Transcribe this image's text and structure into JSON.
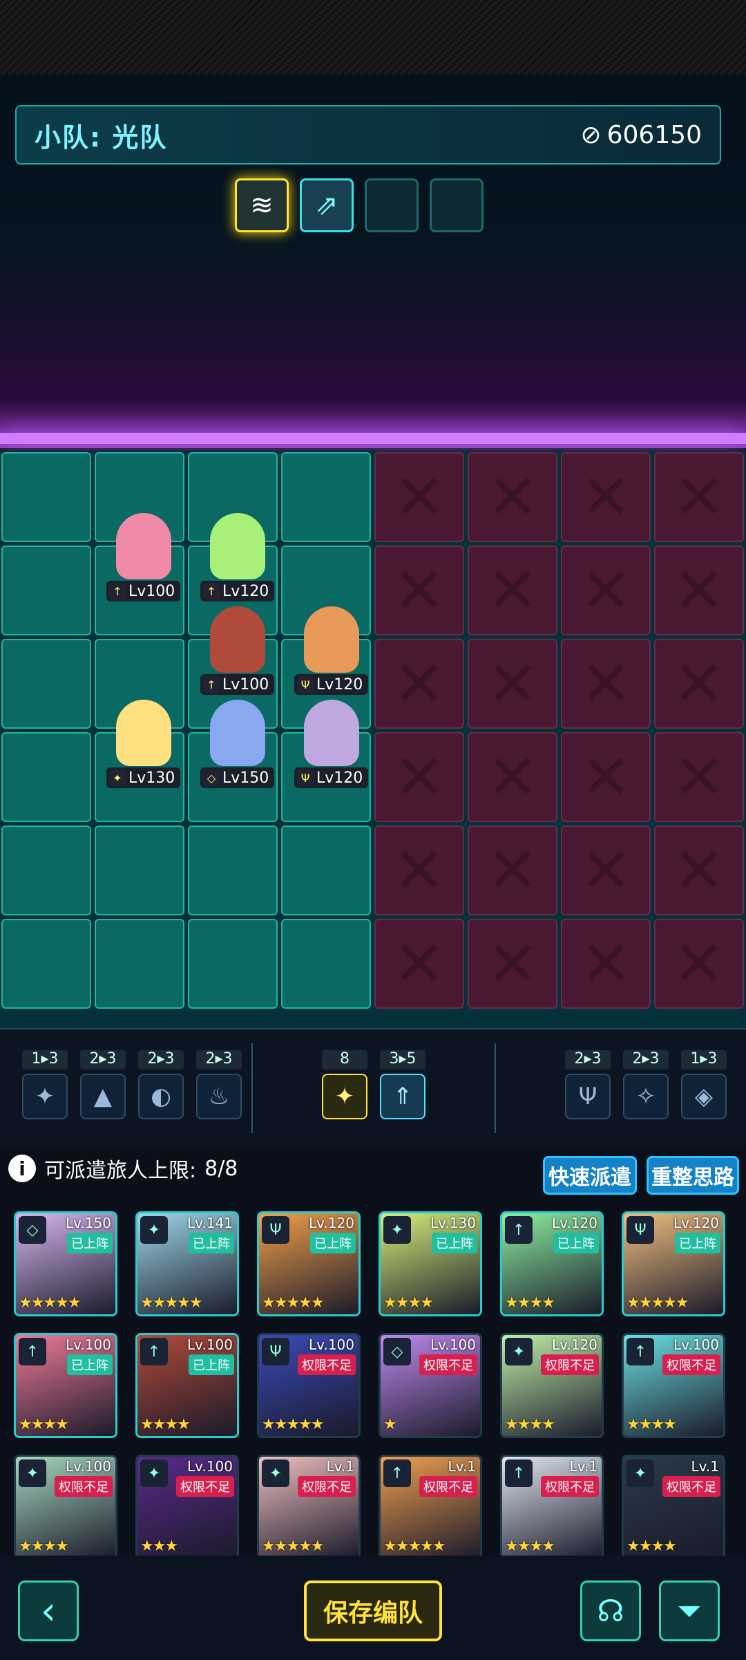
{
  "team": {
    "label": "小队: 光队",
    "power": "606150"
  },
  "board_units": [
    {
      "lv": "Lv100",
      "icon": "↑"
    },
    {
      "lv": "Lv120",
      "icon": "↑"
    },
    {
      "lv": "Lv100",
      "icon": "↑"
    },
    {
      "lv": "Lv120",
      "icon": "Ψ"
    },
    {
      "lv": "Lv130",
      "icon": "✦"
    },
    {
      "lv": "Lv150",
      "icon": "◇"
    },
    {
      "lv": "Lv120",
      "icon": "Ψ"
    }
  ],
  "synergies": [
    {
      "count": "1▸3",
      "icon": "✦"
    },
    {
      "count": "2▸3",
      "icon": "▲"
    },
    {
      "count": "2▸3",
      "icon": "◐"
    },
    {
      "count": "2▸3",
      "icon": "♨"
    },
    {
      "count": "8",
      "icon": "✦"
    },
    {
      "count": "3▸5",
      "icon": "⇑"
    },
    {
      "count": "2▸3",
      "icon": "Ψ"
    },
    {
      "count": "2▸3",
      "icon": "✧"
    },
    {
      "count": "1▸3",
      "icon": "◈"
    }
  ],
  "deploy": {
    "label": "可派遣旅人上限:",
    "value": "8/8",
    "quick": "快速派遣",
    "reset": "重整思路"
  },
  "tags": {
    "deployed": "已上阵",
    "insufficient": "权限不足"
  },
  "cards": [
    {
      "lv": "Lv.150",
      "status": "deployed",
      "stars": "★★★★★",
      "icon": "◇",
      "color": "#d8b8f0"
    },
    {
      "lv": "Lv.141",
      "status": "deployed",
      "stars": "★★★★★",
      "icon": "✦",
      "color": "#9fd8e8"
    },
    {
      "lv": "Lv.120",
      "status": "deployed",
      "stars": "★★★★★",
      "icon": "Ψ",
      "color": "#f2a04a"
    },
    {
      "lv": "Lv.130",
      "status": "deployed",
      "stars": "★★★★",
      "icon": "✦",
      "color": "#d8f07a"
    },
    {
      "lv": "Lv.120",
      "status": "deployed",
      "stars": "★★★★",
      "icon": "↑",
      "color": "#8ef0a0"
    },
    {
      "lv": "Lv.120",
      "status": "deployed",
      "stars": "★★★★★",
      "icon": "Ψ",
      "color": "#f2c080"
    },
    {
      "lv": "Lv.100",
      "status": "deployed",
      "stars": "★★★★",
      "icon": "↑",
      "color": "#f07a9a"
    },
    {
      "lv": "Lv.100",
      "status": "deployed",
      "stars": "★★★★",
      "icon": "↑",
      "color": "#b04a3a"
    },
    {
      "lv": "Lv.100",
      "status": "insufficient",
      "stars": "★★★★★",
      "icon": "Ψ",
      "color": "#3a4ab8"
    },
    {
      "lv": "Lv.100",
      "status": "insufficient",
      "stars": "★",
      "icon": "◇",
      "color": "#c08af0"
    },
    {
      "lv": "Lv.120",
      "status": "insufficient",
      "stars": "★★★★",
      "icon": "✦",
      "color": "#c0f0a8"
    },
    {
      "lv": "Lv.100",
      "status": "insufficient",
      "stars": "★★★★",
      "icon": "↑",
      "color": "#6ae0e0"
    },
    {
      "lv": "Lv.100",
      "status": "insufficient",
      "stars": "★★★★",
      "icon": "✦",
      "color": "#a8d8c0"
    },
    {
      "lv": "Lv.100",
      "status": "insufficient",
      "stars": "★★★",
      "icon": "✦",
      "color": "#5a2a8a"
    },
    {
      "lv": "Lv.1",
      "status": "insufficient",
      "stars": "★★★★★",
      "icon": "✦",
      "color": "#f0c0c0"
    },
    {
      "lv": "Lv.1",
      "status": "insufficient",
      "stars": "★★★★★",
      "icon": "↑",
      "color": "#f0a050"
    },
    {
      "lv": "Lv.1",
      "status": "insufficient",
      "stars": "★★★★",
      "icon": "↑",
      "color": "#e0e8f0"
    },
    {
      "lv": "Lv.1",
      "status": "insufficient",
      "stars": "★★★★",
      "icon": "✦",
      "color": "#2a3a4a"
    }
  ],
  "footer": {
    "save": "保存编队"
  }
}
